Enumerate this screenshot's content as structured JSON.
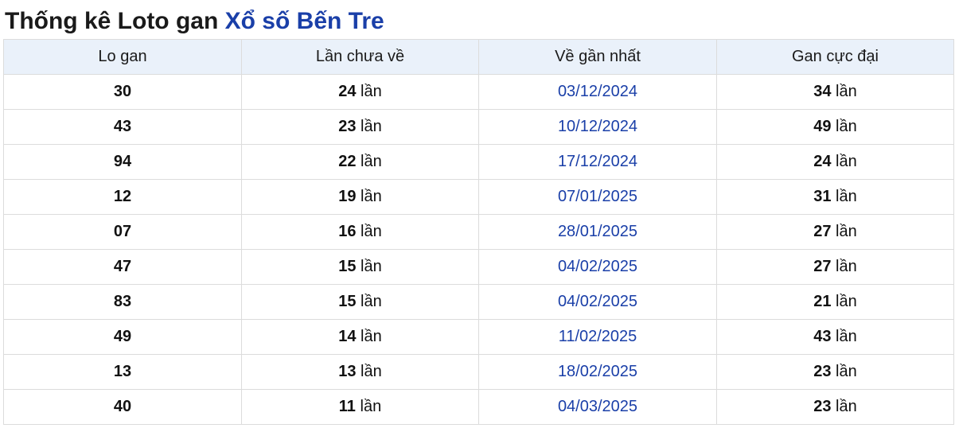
{
  "title": {
    "prefix": "Thống kê Loto gan ",
    "link": "Xổ số Bến Tre"
  },
  "table": {
    "headers": [
      "Lo gan",
      "Lần chưa về",
      "Về gần nhất",
      "Gan cực đại"
    ],
    "unit": "lần",
    "rows": [
      {
        "lo": "30",
        "count": "24",
        "date": "03/12/2024",
        "max": "34"
      },
      {
        "lo": "43",
        "count": "23",
        "date": "10/12/2024",
        "max": "49"
      },
      {
        "lo": "94",
        "count": "22",
        "date": "17/12/2024",
        "max": "24"
      },
      {
        "lo": "12",
        "count": "19",
        "date": "07/01/2025",
        "max": "31"
      },
      {
        "lo": "07",
        "count": "16",
        "date": "28/01/2025",
        "max": "27"
      },
      {
        "lo": "47",
        "count": "15",
        "date": "04/02/2025",
        "max": "27"
      },
      {
        "lo": "83",
        "count": "15",
        "date": "04/02/2025",
        "max": "21"
      },
      {
        "lo": "49",
        "count": "14",
        "date": "11/02/2025",
        "max": "43"
      },
      {
        "lo": "13",
        "count": "13",
        "date": "18/02/2025",
        "max": "23"
      },
      {
        "lo": "40",
        "count": "11",
        "date": "04/03/2025",
        "max": "23"
      }
    ]
  },
  "colors": {
    "link": "#1a3fa8",
    "header_bg": "#eaf1fa",
    "border": "#dcdcdc"
  }
}
